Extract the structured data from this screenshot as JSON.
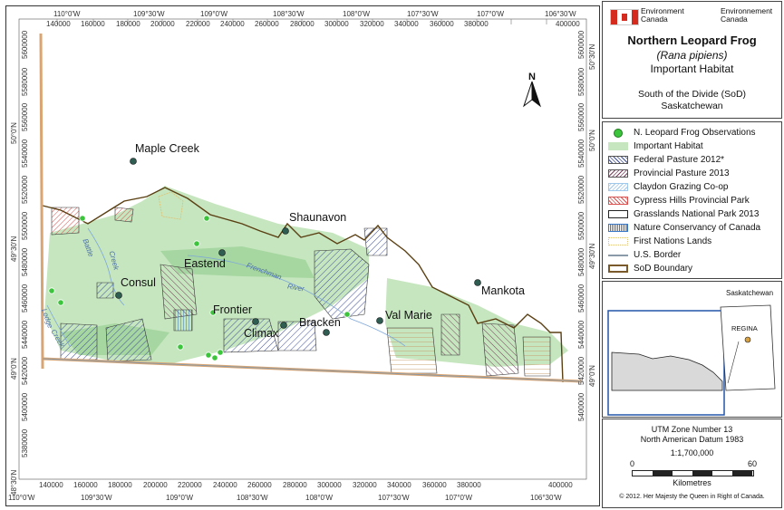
{
  "map": {
    "grid_top": [
      "110°0'W",
      "109°30'W",
      "109°0'W",
      "108°30'W",
      "108°0'W",
      "107°30'W",
      "107°0'W",
      "106°30'W"
    ],
    "easting_top": [
      "140000",
      "160000",
      "180000",
      "200000",
      "220000",
      "240000",
      "260000",
      "280000",
      "300000",
      "320000",
      "340000",
      "360000",
      "380000",
      "400000"
    ],
    "easting_bottom": [
      "140000",
      "160000",
      "180000",
      "200000",
      "220000",
      "240000",
      "260000",
      "280000",
      "300000",
      "320000",
      "340000",
      "360000",
      "380000",
      "400000"
    ],
    "grid_bottom": [
      "110°0'W",
      "109°30'W",
      "109°0'W",
      "108°30'W",
      "108°0'W",
      "107°30'W",
      "107°0'W",
      "106°30'W"
    ],
    "northing_left": [
      "5600000",
      "5580000",
      "5560000",
      "5540000",
      "5520000",
      "5500000",
      "5480000",
      "5460000",
      "5440000",
      "5420000",
      "5400000",
      "5380000"
    ],
    "northing_right": [
      "5600000",
      "5580000",
      "5560000",
      "5540000",
      "5520000",
      "5500000",
      "5480000",
      "5460000",
      "5440000",
      "5420000",
      "5400000"
    ],
    "lat_left": [
      "50°0'N",
      "49°30'N",
      "49°0'N",
      "48°30'N"
    ],
    "lat_right": [
      "50°30'N",
      "50°0'N",
      "49°30'N",
      "49°0'N"
    ],
    "north_label": "N",
    "cities": [
      {
        "name": "Maple Creek"
      },
      {
        "name": "Shaunavon"
      },
      {
        "name": "Eastend"
      },
      {
        "name": "Consul"
      },
      {
        "name": "Frontier"
      },
      {
        "name": "Climax"
      },
      {
        "name": "Bracken"
      },
      {
        "name": "Val Marie"
      },
      {
        "name": "Mankota"
      }
    ],
    "rivers": [
      "Battle",
      "Creek",
      "Frenchman",
      "River",
      "Lodge",
      "Creek"
    ]
  },
  "title_block": {
    "agency_en": "Environment\nCanada",
    "agency_fr": "Environnement\nCanada",
    "title": "Northern Leopard Frog",
    "species": "(Rana pipiens)",
    "subtitle": "Important Habitat",
    "region_1": "South of the Divide (SoD)",
    "region_2": "Saskatchewan"
  },
  "legend": {
    "items": [
      {
        "label": "N. Leopard  Frog Observations",
        "color": "#3cc43c"
      },
      {
        "label": "Important Habitat",
        "color": "#c6e6bf"
      },
      {
        "label": "Federal Pasture 2012*",
        "color": "#3f4f9a"
      },
      {
        "label": "Provincial Pasture 2013",
        "color": "#7a3f5e"
      },
      {
        "label": "Claydon Grazing Co-op",
        "color": "#9fc8ea"
      },
      {
        "label": "Cypress Hills Provincial Park",
        "color": "#d9504f"
      },
      {
        "label": "Grasslands National Park 2013",
        "color": "#222222"
      },
      {
        "label": "Nature Conservancy of Canada",
        "color": "#3a78c9"
      },
      {
        "label": "First Nations Lands",
        "color": "#e0c070"
      },
      {
        "label": "U.S. Border",
        "color": "#8a9aa8"
      },
      {
        "label": "SoD Boundary",
        "color": "#7a5a2a"
      }
    ]
  },
  "inset": {
    "province": "Saskatchewan",
    "capital": "REGINA"
  },
  "scale": {
    "zone": "UTM Zone Number 13",
    "datum": "North American Datum 1983",
    "ratio": "1:1,700,000",
    "left": "0",
    "right": "60",
    "unit": "Kilometres"
  },
  "copyright": "© 2012. Her Majesty the Queen in Right of Canada."
}
